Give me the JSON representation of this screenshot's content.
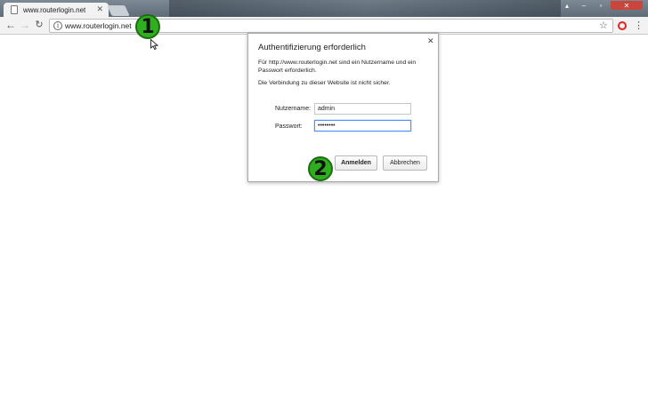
{
  "browser": {
    "tab_title": "www.routerlogin.net",
    "url": "www.routerlogin.net"
  },
  "dialog": {
    "title": "Authentifizierung erforderlich",
    "message": "Für http://www.routerlogin.net sind ein Nutzername und ein Passwort erforderlich.",
    "warning": "Die Verbindung zu dieser Website ist nicht sicher.",
    "username_label": "Nutzername:",
    "username_value": "admin",
    "password_label": "Passwort:",
    "password_value": "••••••••",
    "login_label": "Anmelden",
    "cancel_label": "Abbrechen"
  },
  "annotations": {
    "step1": "1",
    "step2": "2",
    "color": "#2faf1f"
  },
  "colors": {
    "focus_border": "#4d90fe",
    "close_button": "#c9463d",
    "opera_red": "#e8221f"
  }
}
